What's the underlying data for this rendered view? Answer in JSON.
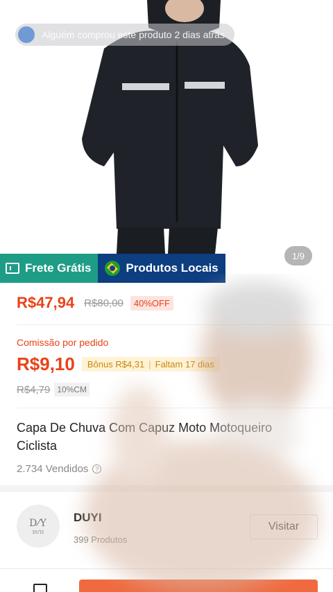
{
  "toast": {
    "text": "Alguém comprou este produto 2 dias atrás"
  },
  "gallery": {
    "counter": "1/9"
  },
  "badges": {
    "frete": "Frete Grátis",
    "local": "Produtos Locais"
  },
  "pricing": {
    "price": "R$47,94",
    "old_price": "R$80,00",
    "discount": "40%OFF"
  },
  "commission": {
    "label": "Comissão por pedido",
    "value": "R$9,10",
    "bonus": "Bônus R$4,31",
    "remaining": "Faltam 17 dias",
    "old_value": "R$4,79",
    "percent": "10%CM"
  },
  "product": {
    "title": "Capa De Chuva Com Capuz Moto Motoqueiro Ciclista",
    "sold": "2.734 Vendidos"
  },
  "store": {
    "logo_text": "DUYI",
    "name": "DUYI",
    "products": "399 Produtos",
    "visit": "Visitar"
  },
  "colors": {
    "accent": "#e84318",
    "frete": "#1f9c86",
    "local": "#0c3e80"
  },
  "icons": [
    "store-icon",
    "help-icon",
    "truck-icon",
    "brazil-flag-icon"
  ]
}
